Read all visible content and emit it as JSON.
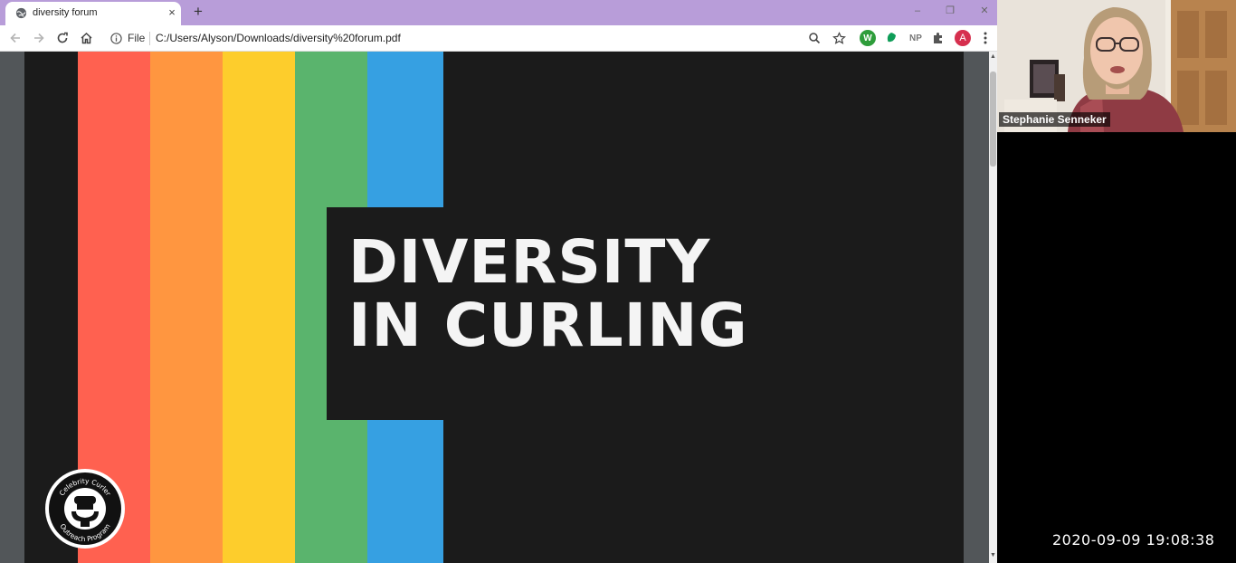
{
  "browser": {
    "tab": {
      "title": "diversity forum",
      "close_glyph": "×"
    },
    "new_tab_glyph": "+",
    "window_controls": {
      "minimize": "–",
      "restore": "❐",
      "close": "✕"
    },
    "address_bar": {
      "scheme_label": "File",
      "url": "C:/Users/Alyson/Downloads/diversity%20forum.pdf"
    },
    "extensions": [
      {
        "icon": "w-extension-icon",
        "label": "W",
        "color": "#2e9d3b"
      },
      {
        "icon": "leaf-extension-icon",
        "label": "",
        "color": "#0f9d58"
      },
      {
        "icon": "np-extension-icon",
        "label": "NP",
        "color": "#777777"
      },
      {
        "icon": "puzzle-icon",
        "label": "",
        "color": "#555555"
      }
    ],
    "profile_initial": "A"
  },
  "slide": {
    "title_line1": "DIVERSITY",
    "title_line2": "IN CURLING",
    "stripe_colors": [
      "#ff6150",
      "#ff9640",
      "#fdcd2c",
      "#5ab46d",
      "#36a0e2"
    ],
    "logo": {
      "top_text": "Celebrity Curler",
      "bottom_text": "Outreach Program"
    }
  },
  "video": {
    "participant_name": "Stephanie Senneker",
    "timestamp": "2020-09-09 19:08:38"
  }
}
